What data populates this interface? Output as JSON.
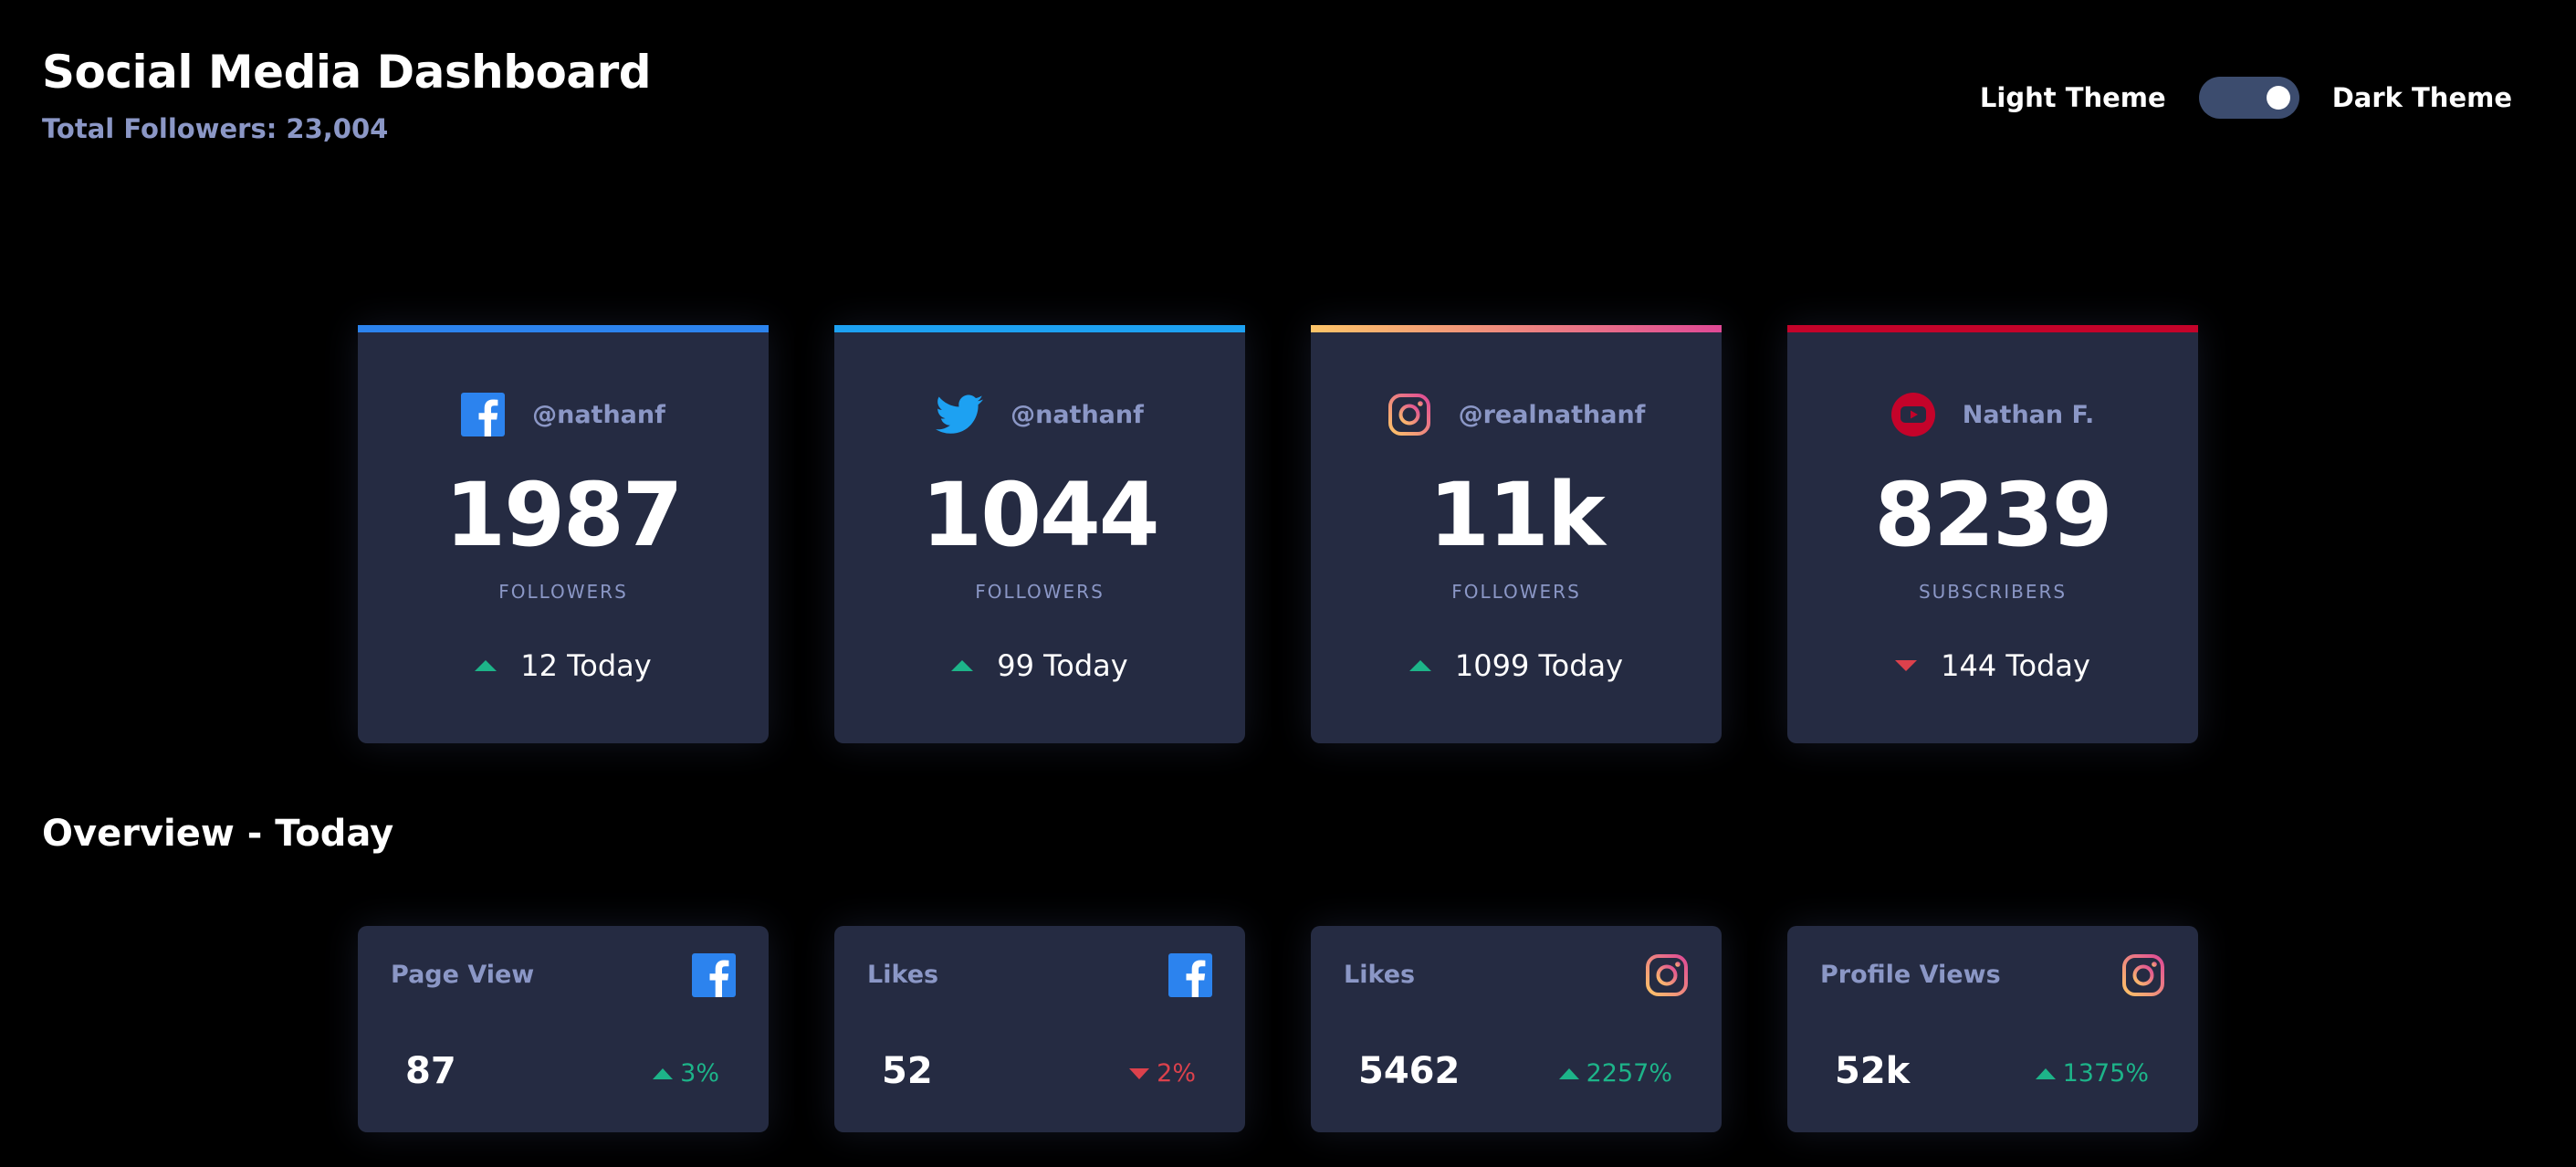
{
  "header": {
    "title": "Social Media Dashboard",
    "subtitle": "Total Followers: 23,004",
    "theme_light_label": "Light Theme",
    "theme_dark_label": "Dark Theme",
    "theme_toggle_state": "dark"
  },
  "colors": {
    "background": "#000000",
    "card": "#252b42",
    "muted_text": "#8b97c6",
    "up": "#1db489",
    "down": "#dc414c",
    "facebook": "#2c83ee",
    "twitter": "#1da1f2",
    "youtube": "#c4032a",
    "instagram_gradient": [
      "#fdc468",
      "#df4996"
    ]
  },
  "follower_cards": [
    {
      "platform": "facebook",
      "icon": "facebook-icon",
      "handle": "@nathanf",
      "count": "1987",
      "unit": "FOLLOWERS",
      "today": "12 Today",
      "trend": "up"
    },
    {
      "platform": "twitter",
      "icon": "twitter-icon",
      "handle": "@nathanf",
      "count": "1044",
      "unit": "FOLLOWERS",
      "today": "99 Today",
      "trend": "up"
    },
    {
      "platform": "instagram",
      "icon": "instagram-icon",
      "handle": "@realnathanf",
      "count": "11k",
      "unit": "FOLLOWERS",
      "today": "1099 Today",
      "trend": "up"
    },
    {
      "platform": "youtube",
      "icon": "youtube-icon",
      "handle": "Nathan F.",
      "count": "8239",
      "unit": "SUBSCRIBERS",
      "today": "144 Today",
      "trend": "down"
    }
  ],
  "overview": {
    "title": "Overview - Today",
    "cards": [
      {
        "label": "Page View",
        "icon": "facebook-icon",
        "value": "87",
        "change": "3%",
        "trend": "up"
      },
      {
        "label": "Likes",
        "icon": "facebook-icon",
        "value": "52",
        "change": "2%",
        "trend": "down"
      },
      {
        "label": "Likes",
        "icon": "instagram-icon",
        "value": "5462",
        "change": "2257%",
        "trend": "up"
      },
      {
        "label": "Profile Views",
        "icon": "instagram-icon",
        "value": "52k",
        "change": "1375%",
        "trend": "up"
      }
    ]
  }
}
